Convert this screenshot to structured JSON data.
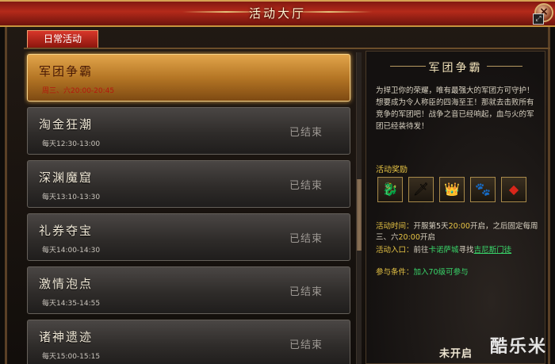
{
  "window": {
    "title": "活动大厅",
    "close_label": "×"
  },
  "tabs": [
    {
      "label": "日常活动"
    }
  ],
  "events": [
    {
      "name": "军团争霸",
      "time": "周三、六20:00-20:45",
      "status": ""
    },
    {
      "name": "淘金狂潮",
      "time": "每天12:30-13:00",
      "status": "已结束"
    },
    {
      "name": "深渊魔窟",
      "time": "每天13:10-13:30",
      "status": "已结束"
    },
    {
      "name": "礼券夺宝",
      "time": "每天14:00-14:30",
      "status": "已结束"
    },
    {
      "name": "激情泡点",
      "time": "每天14:35-14:55",
      "status": "已结束"
    },
    {
      "name": "诸神遗迹",
      "time": "每天15:00-15:15",
      "status": "已结束"
    }
  ],
  "detail": {
    "title": "军团争霸",
    "description": "为捍卫你的荣耀，唯有最强大的军团方可守护！想要成为令人称臣的四海至王！那就去击败所有竞争的军团吧！战争之音已经响起，血与火的军团已经装待发！",
    "reward_label": "活动奖励",
    "rewards": [
      {
        "icon": "dragon-armor-icon",
        "glyph": "🐉"
      },
      {
        "icon": "sword-icon",
        "glyph": "🗡"
      },
      {
        "icon": "crown-icon",
        "glyph": "👑"
      },
      {
        "icon": "pet-icon",
        "glyph": "🐾"
      },
      {
        "icon": "red-gem-icon",
        "glyph": "◆"
      }
    ],
    "time_label": "活动时间：",
    "time_text_a": "开服第5天",
    "time_hl_a": "20:00",
    "time_text_b": "开启，之后固定每周三、六",
    "time_hl_b": "20:00",
    "time_text_c": "开启",
    "entry_label": "活动入口：",
    "entry_text": "前往",
    "entry_link_a": "卡诺萨城",
    "entry_text_b": "寻找",
    "entry_link_b": "吉尼斯门徒",
    "cond_label": "参与条件：",
    "cond_value": "加入70级可参与",
    "button_label": "未开启"
  },
  "watermark": "酷乐米",
  "colors": {
    "accent_gold": "#e8c545",
    "link_green": "#39d66a",
    "title_red": "#b42a1a"
  }
}
